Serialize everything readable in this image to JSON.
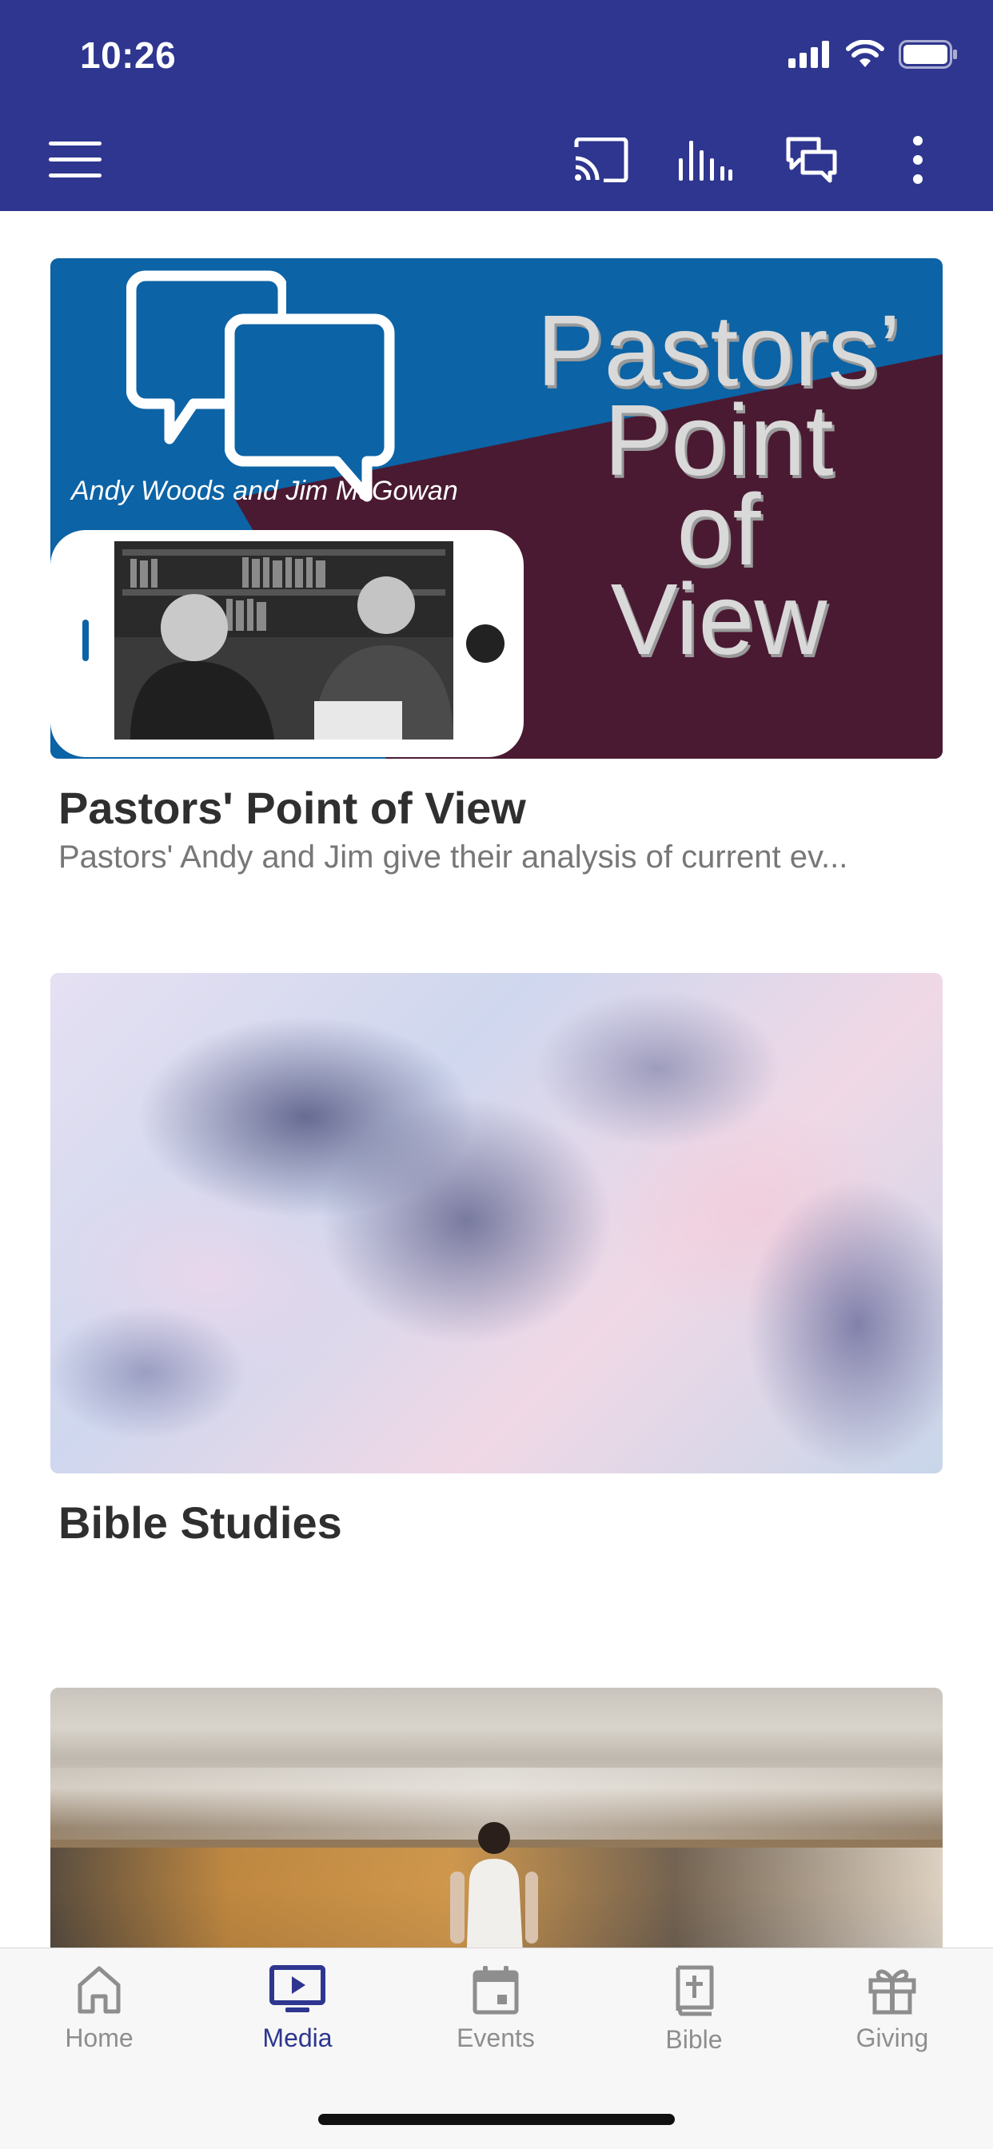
{
  "status_bar": {
    "time": "10:26"
  },
  "toolbar": {
    "icons": [
      "menu-icon",
      "cast-icon",
      "audio-bars-icon",
      "chat-icon",
      "more-vertical-icon"
    ]
  },
  "cards": [
    {
      "title": "Pastors' Point of View",
      "subtitle": "Pastors' Andy and Jim give their analysis of current ev...",
      "image": {
        "caption": "Andy Woods and Jim McGowan",
        "words": [
          "Pastors’",
          "Point",
          "of",
          "View"
        ]
      }
    },
    {
      "title": "Bible Studies",
      "subtitle": ""
    },
    {
      "title": "",
      "subtitle": ""
    }
  ],
  "bottom_nav": {
    "items": [
      {
        "label": "Home",
        "icon": "home-icon",
        "active": false
      },
      {
        "label": "Media",
        "icon": "media-icon",
        "active": true
      },
      {
        "label": "Events",
        "icon": "calendar-icon",
        "active": false
      },
      {
        "label": "Bible",
        "icon": "bible-icon",
        "active": false
      },
      {
        "label": "Giving",
        "icon": "gift-icon",
        "active": false
      }
    ]
  },
  "colors": {
    "header_bg": "#2e368f",
    "active_nav": "#2e368f",
    "inactive_nav": "#8e8e8e"
  }
}
